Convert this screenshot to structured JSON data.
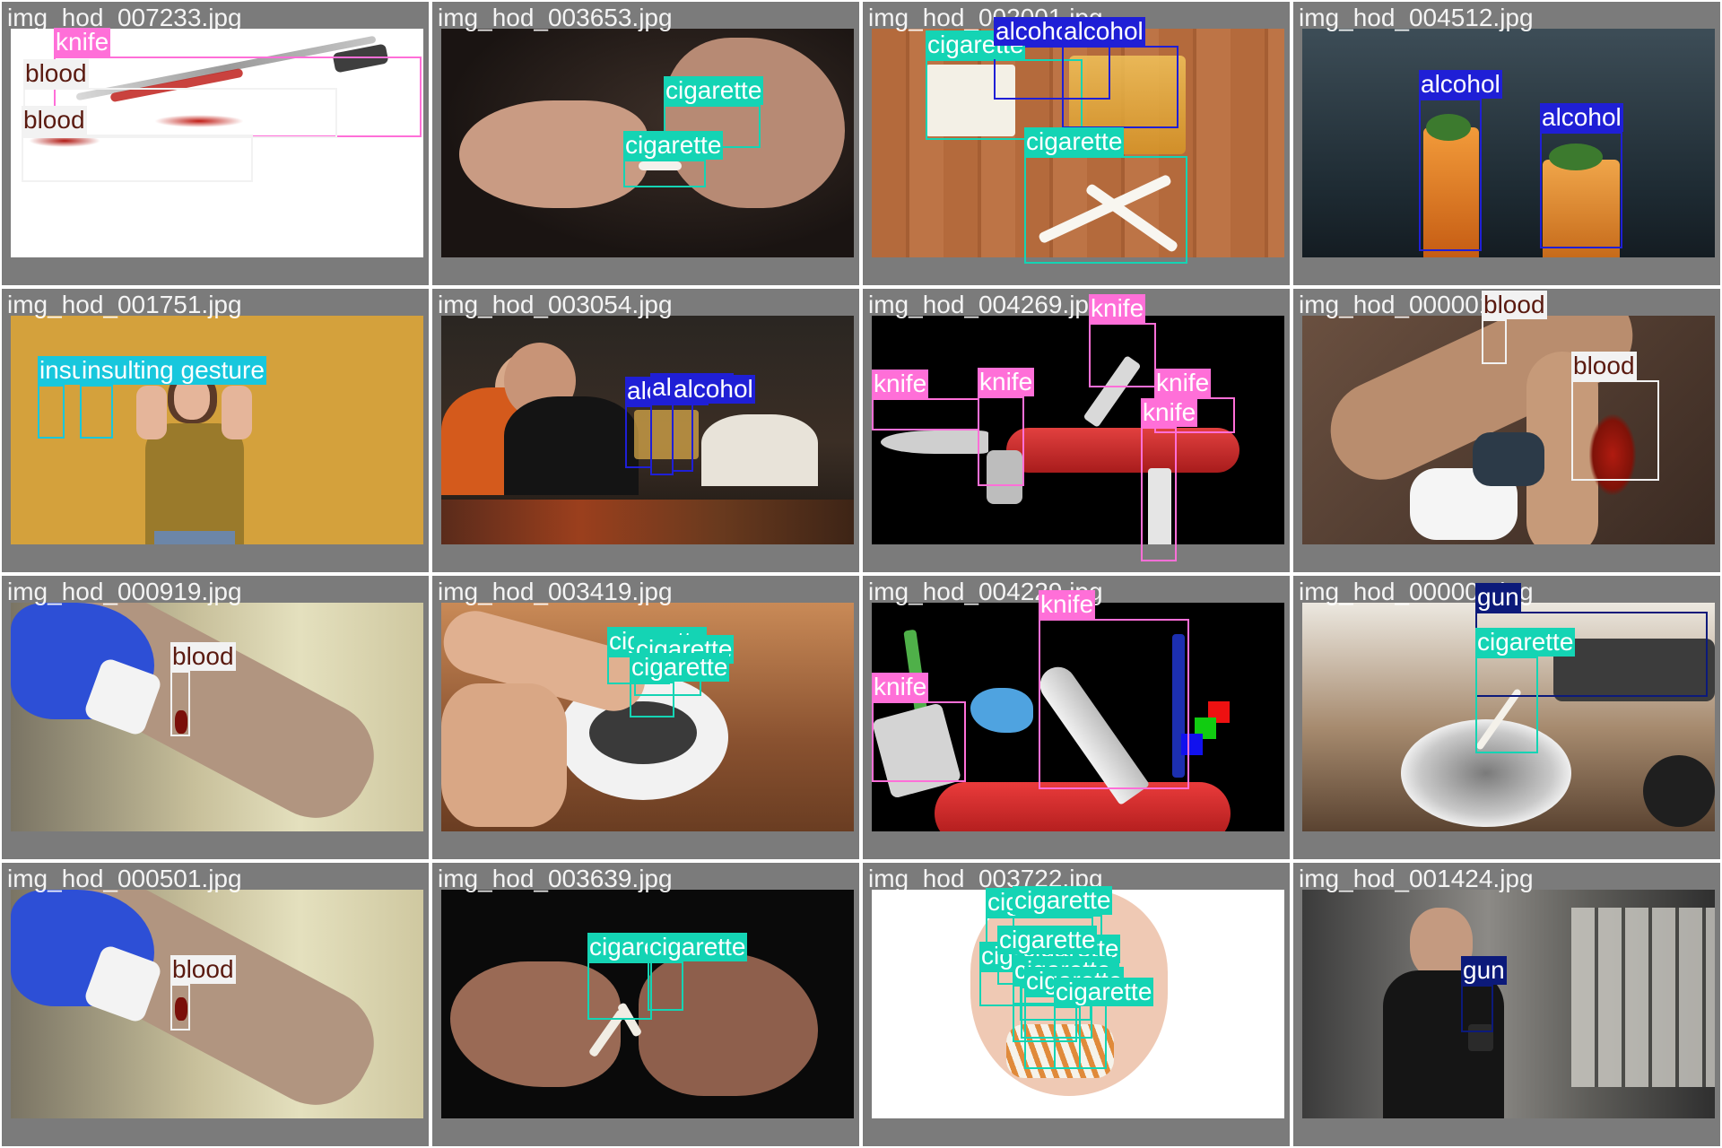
{
  "class_colors": {
    "knife": "#ff6fd8",
    "blood": "#f2f2f2",
    "cigarette": "#14d4b4",
    "alcohol": "#1f1fd6",
    "insulting gesture": "#18c7dd",
    "gun": "#0c1a7a"
  },
  "label_text_colors": {
    "knife": "#ffffff",
    "blood": "#5a1a10",
    "cigarette": "#ffffff",
    "alcohol": "#ffffff",
    "insulting gesture": "#ffffff",
    "gun": "#ffffff"
  },
  "tiles": [
    {
      "filename": "img_hod_007233.jpg",
      "scene": "knife-blood",
      "detections": [
        {
          "cls": "knife",
          "label": "knife"
        },
        {
          "cls": "blood",
          "label": "blood"
        },
        {
          "cls": "blood",
          "label": "blood"
        }
      ]
    },
    {
      "filename": "img_hod_003653.jpg",
      "scene": "hands-dark",
      "detections": [
        {
          "cls": "cigarette",
          "label": "cigarette"
        },
        {
          "cls": "cigarette",
          "label": "cigarette"
        }
      ]
    },
    {
      "filename": "img_hod_002001.jpg",
      "scene": "table-wood",
      "detections": [
        {
          "cls": "cigarette",
          "label": "cigarette"
        },
        {
          "cls": "alcohol",
          "label": "alcohol"
        },
        {
          "cls": "alcohol",
          "label": "alcohol"
        },
        {
          "cls": "cigarette",
          "label": "cigarette"
        }
      ]
    },
    {
      "filename": "img_hod_004512.jpg",
      "scene": "cocktails",
      "detections": [
        {
          "cls": "alcohol",
          "label": "alcohol"
        },
        {
          "cls": "alcohol",
          "label": "alcohol"
        }
      ]
    },
    {
      "filename": "img_hod_001751.jpg",
      "scene": "mustard-wall",
      "detections": [
        {
          "cls": "insulting gesture",
          "label": "insulting gesture"
        },
        {
          "cls": "insulting gesture",
          "label": "insulting gesture"
        }
      ]
    },
    {
      "filename": "img_hod_003054.jpg",
      "scene": "dinner",
      "detections": [
        {
          "cls": "alcohol",
          "label": "alcohol"
        },
        {
          "cls": "alcohol",
          "label": "alcohol"
        },
        {
          "cls": "alcohol",
          "label": "alcohol"
        }
      ]
    },
    {
      "filename": "img_hod_004269.jpg",
      "scene": "swiss-knife-black",
      "detections": [
        {
          "cls": "knife",
          "label": "knife"
        },
        {
          "cls": "knife",
          "label": "knife"
        },
        {
          "cls": "knife",
          "label": "knife"
        },
        {
          "cls": "knife",
          "label": "knife"
        },
        {
          "cls": "knife",
          "label": "knife"
        }
      ]
    },
    {
      "filename": "img_hod_000001.jpg",
      "scene": "leg-wound",
      "detections": [
        {
          "cls": "blood",
          "label": "blood"
        },
        {
          "cls": "blood",
          "label": "blood"
        }
      ]
    },
    {
      "filename": "img_hod_000919.jpg",
      "scene": "arm-glove",
      "detections": [
        {
          "cls": "blood",
          "label": "blood"
        }
      ]
    },
    {
      "filename": "img_hod_003419.jpg",
      "scene": "ashtray-hand",
      "detections": [
        {
          "cls": "cigarette",
          "label": "cigarette"
        },
        {
          "cls": "cigarette",
          "label": "cigarette"
        },
        {
          "cls": "cigarette",
          "label": "cigarette"
        }
      ]
    },
    {
      "filename": "img_hod_004229.jpg",
      "scene": "swiss-knife-icons",
      "detections": [
        {
          "cls": "knife",
          "label": "knife"
        },
        {
          "cls": "knife",
          "label": "knife"
        }
      ]
    },
    {
      "filename": "img_hod_000001.jpg",
      "scene": "ashtray-gun",
      "detections": [
        {
          "cls": "gun",
          "label": "gun"
        },
        {
          "cls": "cigarette",
          "label": "cigarette"
        }
      ]
    },
    {
      "filename": "img_hod_000501.jpg",
      "scene": "arm-glove",
      "detections": [
        {
          "cls": "blood",
          "label": "blood"
        }
      ]
    },
    {
      "filename": "img_hod_003639.jpg",
      "scene": "hands-break",
      "detections": [
        {
          "cls": "cigarette",
          "label": "cigarette"
        },
        {
          "cls": "cigarette",
          "label": "cigarette"
        }
      ]
    },
    {
      "filename": "img_hod_003722.jpg",
      "scene": "handful",
      "detections": [
        {
          "cls": "cigarette",
          "label": "cigarette"
        },
        {
          "cls": "cigarette",
          "label": "cigarette"
        },
        {
          "cls": "cigarette",
          "label": "cigarette"
        },
        {
          "cls": "cigarette",
          "label": "cigarette"
        },
        {
          "cls": "cigarette",
          "label": "cigarette"
        },
        {
          "cls": "cigarette",
          "label": "cigarette"
        },
        {
          "cls": "cigarette",
          "label": "cigarette"
        },
        {
          "cls": "cigarette",
          "label": "cigarette"
        },
        {
          "cls": "cigarette",
          "label": "cigarette"
        }
      ]
    },
    {
      "filename": "img_hod_001424.jpg",
      "scene": "warehouse-man",
      "detections": [
        {
          "cls": "gun",
          "label": "gun"
        }
      ]
    }
  ]
}
